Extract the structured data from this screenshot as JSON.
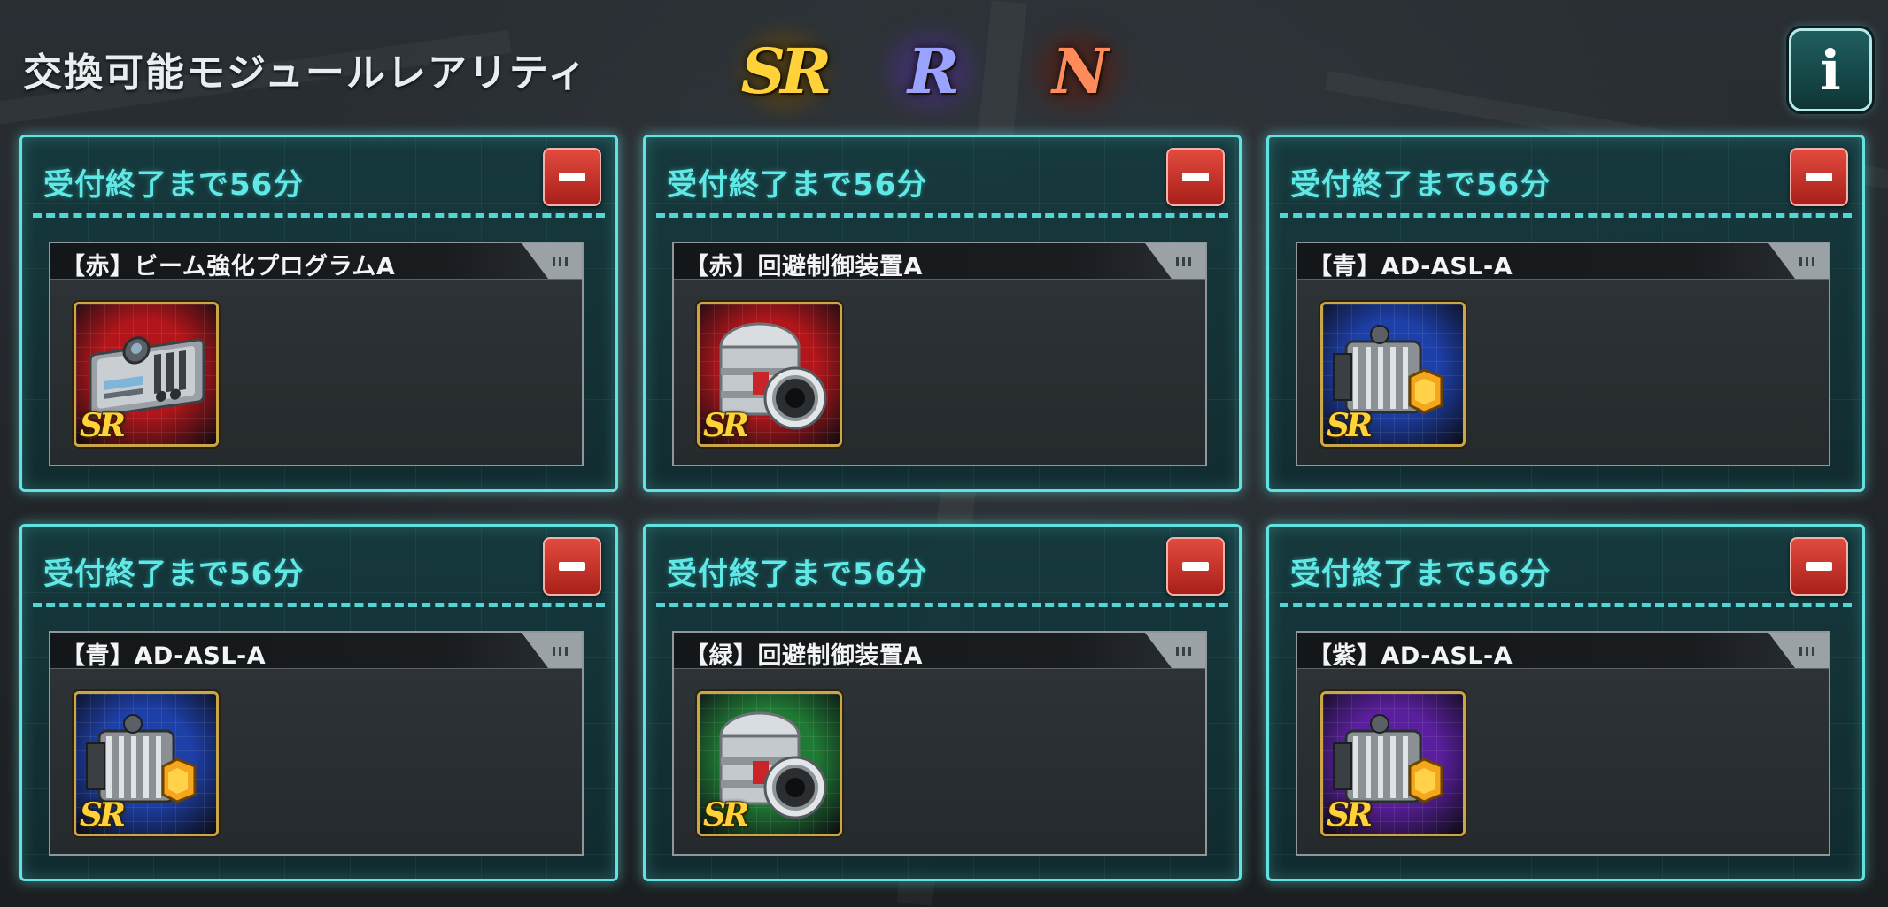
{
  "header": {
    "title": "交換可能モジュールレアリティ",
    "rarities": [
      {
        "label": "SR",
        "icon": "sr-rarity-icon",
        "color": "#ffd23a"
      },
      {
        "label": "R",
        "icon": "r-rarity-icon",
        "color": "#9aa2ff"
      },
      {
        "label": "N",
        "icon": "n-rarity-icon",
        "color": "#ff8b5a"
      }
    ],
    "info_label": "i"
  },
  "colors": {
    "card_border": "#5fe2e0",
    "timer_text": "#5fe8e6",
    "remove_button": "#c8332a"
  },
  "cards": [
    {
      "timer": "受付終了まで56分",
      "module_name": "【赤】ビーム強化プログラムA",
      "rarity": "SR",
      "color": "red",
      "color_hex": "#b3161a",
      "icon": "program-module-icon"
    },
    {
      "timer": "受付終了まで56分",
      "module_name": "【赤】回避制御装置A",
      "rarity": "SR",
      "color": "red",
      "color_hex": "#b3161a",
      "icon": "cylinder-module-icon"
    },
    {
      "timer": "受付終了まで56分",
      "module_name": "【青】AD-ASL-A",
      "rarity": "SR",
      "color": "blue",
      "color_hex": "#1d3fa8",
      "icon": "coil-module-icon"
    },
    {
      "timer": "受付終了まで56分",
      "module_name": "【青】AD-ASL-A",
      "rarity": "SR",
      "color": "blue",
      "color_hex": "#1d3fa8",
      "icon": "coil-module-icon"
    },
    {
      "timer": "受付終了まで56分",
      "module_name": "【緑】回避制御装置A",
      "rarity": "SR",
      "color": "green",
      "color_hex": "#1f7a34",
      "icon": "cylinder-module-icon"
    },
    {
      "timer": "受付終了まで56分",
      "module_name": "【紫】AD-ASL-A",
      "rarity": "SR",
      "color": "purple",
      "color_hex": "#5a1f9e",
      "icon": "coil-module-icon"
    }
  ]
}
